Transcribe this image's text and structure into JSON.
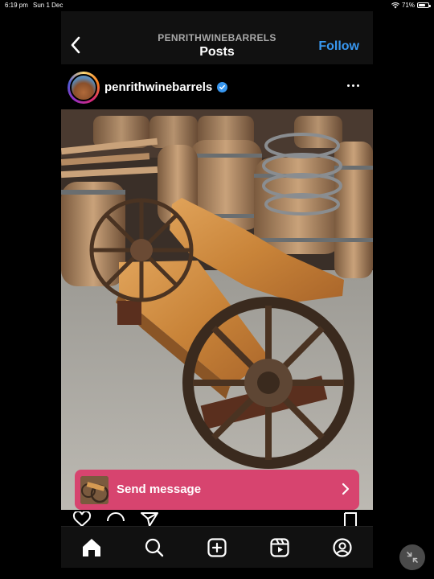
{
  "status_bar": {
    "time": "6:19 pm",
    "date": "Sun 1 Dec",
    "battery": "71%",
    "battery_level": 0.71
  },
  "header": {
    "account": "PENRITHWINEBARRELS",
    "title": "Posts",
    "follow_label": "Follow"
  },
  "post": {
    "username": "penrithwinebarrels",
    "verified": true,
    "image_icon": "wagon-wheel-bench-photo"
  },
  "send_message": {
    "label": "Send message"
  },
  "icons": {
    "back": "chevron-left-icon",
    "more": "more-dots-icon",
    "like": "heart-icon",
    "comment": "comment-icon",
    "share": "send-icon",
    "save": "bookmark-icon",
    "home": "home-icon",
    "search": "search-icon",
    "create": "plus-square-icon",
    "reels": "reels-icon",
    "profile": "profile-icon",
    "collapse": "collapse-icon"
  },
  "colors": {
    "accent": "#3897f0",
    "banner": "#d7446f",
    "background": "#000000",
    "bar": "#111111"
  }
}
